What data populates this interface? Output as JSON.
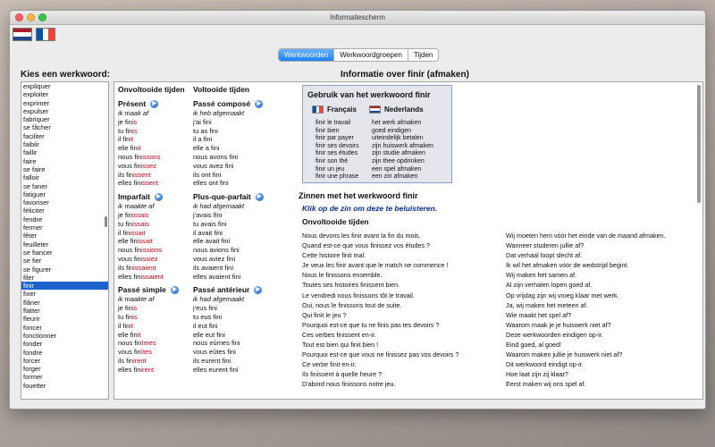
{
  "window": {
    "title": "Informatiescherm"
  },
  "tabs": [
    {
      "label": "Werkwoorden",
      "active": true
    },
    {
      "label": "Werkwoordgroepen",
      "active": false
    },
    {
      "label": "Tijden",
      "active": false
    }
  ],
  "left_title": "Kies een werkwoord:",
  "right_title": "Informatie over finir (afmaken)",
  "verbs": [
    "expliquer",
    "exploiter",
    "exprimer",
    "expulser",
    "fabriquer",
    "se fâcher",
    "faciliter",
    "faiblir",
    "faillir",
    "faire",
    "se faire",
    "falloir",
    "se faner",
    "fatiguer",
    "favoriser",
    "féliciter",
    "fendre",
    "fermer",
    "fêter",
    "feuilleter",
    "se fiancer",
    "se fier",
    "se figurer",
    "filer",
    "finir",
    "fixer",
    "flâner",
    "flatter",
    "fleurir",
    "foncer",
    "fonctionner",
    "fonder",
    "fondre",
    "forcer",
    "forger",
    "former",
    "fouetter"
  ],
  "selected_verb": "finir",
  "columns": {
    "col1_header": "Onvoltooide tijden",
    "col2_header": "Voltooide tijden"
  },
  "tenses": {
    "present": {
      "name": "Présent",
      "pronoun": "ik maak af",
      "forms": [
        [
          "je fin",
          "i",
          "s"
        ],
        [
          "tu fin",
          "i",
          "s"
        ],
        [
          "il fin",
          "i",
          "t"
        ],
        [
          "elle fin",
          "i",
          "t"
        ],
        [
          "nous fin",
          "issons",
          ""
        ],
        [
          "vous fin",
          "issez",
          ""
        ],
        [
          "ils fin",
          "issent",
          ""
        ],
        [
          "elles fin",
          "issent",
          ""
        ]
      ]
    },
    "imparfait": {
      "name": "Imparfait",
      "pronoun": "ik maakte af",
      "forms": [
        [
          "je fin",
          "issais",
          ""
        ],
        [
          "tu fin",
          "issais",
          ""
        ],
        [
          "il fin",
          "issait",
          ""
        ],
        [
          "elle fin",
          "issait",
          ""
        ],
        [
          "nous fin",
          "issions",
          ""
        ],
        [
          "vous fin",
          "issiez",
          ""
        ],
        [
          "ils fin",
          "issaient",
          ""
        ],
        [
          "elles fin",
          "issaient",
          ""
        ]
      ]
    },
    "passe_simple": {
      "name": "Passé simple",
      "pronoun": "ik maakte af",
      "forms": [
        [
          "je fin",
          "is",
          ""
        ],
        [
          "tu fin",
          "is",
          ""
        ],
        [
          "il fin",
          "it",
          ""
        ],
        [
          "elle fin",
          "it",
          ""
        ],
        [
          "nous fin",
          "îmes",
          ""
        ],
        [
          "vous fin",
          "îtes",
          ""
        ],
        [
          "ils fin",
          "irent",
          ""
        ],
        [
          "elles fin",
          "irent",
          ""
        ]
      ]
    },
    "passe_compose": {
      "name": "Passé composé",
      "pronoun": "ik heb afgemaakt",
      "forms": [
        "j'ai fini",
        "tu as fini",
        "il a fini",
        "elle a fini",
        "nous avons fini",
        "vous avez fini",
        "ils ont fini",
        "elles ont fini"
      ]
    },
    "plus_que_parfait": {
      "name": "Plus-que-parfait",
      "pronoun": "ik had afgemaakt",
      "forms": [
        "j'avais fini",
        "tu avais fini",
        "il avait fini",
        "elle avait fini",
        "nous avions fini",
        "vous aviez fini",
        "ils avaient fini",
        "elles avaient fini"
      ]
    },
    "passe_anterieur": {
      "name": "Passé antérieur",
      "pronoun": "ik had afgemaakt",
      "forms": [
        "j'eus fini",
        "tu eus fini",
        "il eut fini",
        "elle eut fini",
        "nous eûmes fini",
        "vous eûtes fini",
        "ils eurent fini",
        "elles eurent fini"
      ]
    }
  },
  "usage": {
    "title": "Gebruik van het werkwoord finir",
    "lang_fr": "Français",
    "lang_nl": "Nederlands",
    "fr": [
      "finir le travail",
      "finir bien",
      "finir par payer",
      "finir ses devoirs",
      "finir ses études",
      "finir son thé",
      "finir un jeu",
      "finir une phrase"
    ],
    "nl": [
      "het werk afmaken",
      "goed eindigen",
      "uiteindelijk betalen",
      "zijn huiswerk afmaken",
      "zijn studie afmaken",
      "zijn thee opdrinken",
      "een spel afmaken",
      "een zin afmaken"
    ]
  },
  "sentences": {
    "title": "Zinnen met het werkwoord finir",
    "link": "Klik op de zin om deze te beluisteren.",
    "tense": "Onvoltooide tijden",
    "fr": [
      "Nous devons les finir avant la fin du mois.",
      "Quand est-ce que vous finissez vos études ?",
      "Cette histoire finit mal.",
      "Je veux les finir avant que le match ne commence !",
      "Nous le finissons ensemble.",
      "Toutes ses histoires finissent bien.",
      "Le vendredi nous finissons tôt le travail.",
      "Oui, nous le finissons tout de suite.",
      "Qui finit le jeu ?",
      "Pourquoi est-ce que tu ne finis pas tes devoirs ?",
      "Ces verbes finissent en-ir.",
      "Tout est bien qui finit bien !",
      "Pourquoi est-ce que vous ne finissez pas vos devoirs ?",
      "Ce verbe finit en-ir.",
      "Ils finissent à quelle heure ?",
      "D'abord nous finissons notre jeu."
    ],
    "nl": [
      "Wij moeten hem vóór het einde van de maand afmaken.",
      "Wanneer studeren jullie af?",
      "Dat verhaal loopt slecht af.",
      "Ik wil het afmaken vóór de wedstrijd begint.",
      "Wij maken het samen af.",
      "Al zijn verhalen lopen goed af.",
      "Op vrijdag zijn wij vroeg klaar met werk.",
      "Ja, wij maken het meteen af.",
      "Wie maakt het spel af?",
      "Waarom maak je je huiswerk niet af?",
      "Deze werkwoorden eindigen op-ir.",
      "Eind goed, al goed!",
      "Waarom maken jullie je huiswerk niet af?",
      "Dit werkwoord eindigt op-ir.",
      "Hoe laat zijn zij klaar?",
      "Eerst maken wij ons spel af."
    ]
  },
  "colors": {
    "accent": "#1a82fb",
    "ending": "#d6001c",
    "link": "#0b2fa0",
    "selection": "#1e62d0"
  }
}
